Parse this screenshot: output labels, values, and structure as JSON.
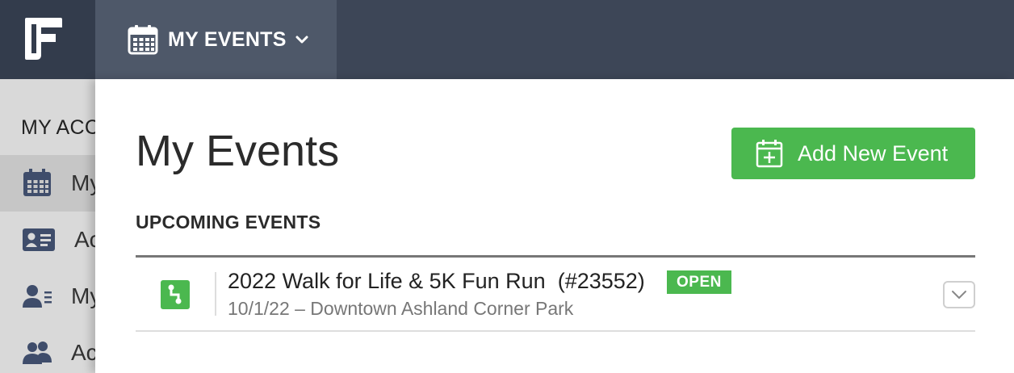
{
  "topbar": {
    "nav_label": "MY EVENTS",
    "bar_color": "#3d4657"
  },
  "sidebar": {
    "section_label": "MY ACC",
    "items": [
      {
        "label": "My",
        "icon": "calendar-icon",
        "active": true
      },
      {
        "label": "Ac",
        "icon": "id-card-icon",
        "active": false
      },
      {
        "label": "My",
        "icon": "user-list-icon",
        "active": false
      },
      {
        "label": "Ac",
        "icon": "users-icon",
        "active": false
      }
    ]
  },
  "main": {
    "title": "My Events",
    "add_button_label": "Add New Event",
    "section_title": "UPCOMING EVENTS",
    "events": [
      {
        "name": "2022 Walk for Life & 5K Fun Run  (#23552)",
        "status": "OPEN",
        "details": "10/1/22 – Downtown Ashland Corner Park",
        "icon": "race-route-icon"
      }
    ]
  },
  "colors": {
    "accent_green": "#4bb84f",
    "nav_dark": "#3d4657",
    "nav_active": "#4e5869"
  }
}
